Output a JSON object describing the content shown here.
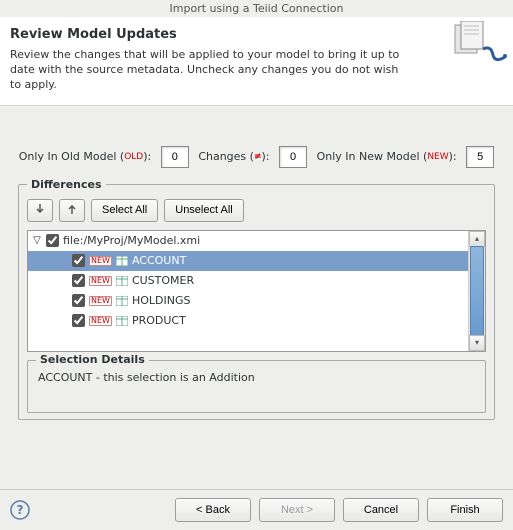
{
  "window": {
    "title": "Import using a Teiid Connection"
  },
  "banner": {
    "title": "Review Model Updates",
    "description": "Review the changes that will be applied to your model to bring it up to date with the source metadata. Uncheck any changes you do not wish to apply."
  },
  "counters": {
    "old_label": "Only In Old Model (",
    "old_suffix": "): ",
    "old_value": "0",
    "changes_label": "Changes (",
    "changes_suffix": "): ",
    "changes_value": "0",
    "new_label": "Only In New Model (",
    "new_suffix": "): ",
    "new_value": "5",
    "old_tag": "OLD",
    "chg_tag": "≠",
    "new_tag": "NEW"
  },
  "differences": {
    "legend": "Differences",
    "expand_icon": "expand-icon",
    "collapse_icon": "collapse-icon",
    "select_all": "Select All",
    "unselect_all": "Unselect All",
    "root": {
      "checked": true,
      "label": "file:/MyProj/MyModel.xmi"
    },
    "items": [
      {
        "checked": true,
        "label": "ACCOUNT",
        "selected": true
      },
      {
        "checked": true,
        "label": "CUSTOMER",
        "selected": false
      },
      {
        "checked": true,
        "label": "HOLDINGS",
        "selected": false
      },
      {
        "checked": true,
        "label": "PRODUCT",
        "selected": false
      }
    ]
  },
  "selection_details": {
    "legend": "Selection Details",
    "text": "ACCOUNT - this selection is an Addition"
  },
  "footer": {
    "back": "< Back",
    "next": "Next >",
    "cancel": "Cancel",
    "finish": "Finish"
  }
}
